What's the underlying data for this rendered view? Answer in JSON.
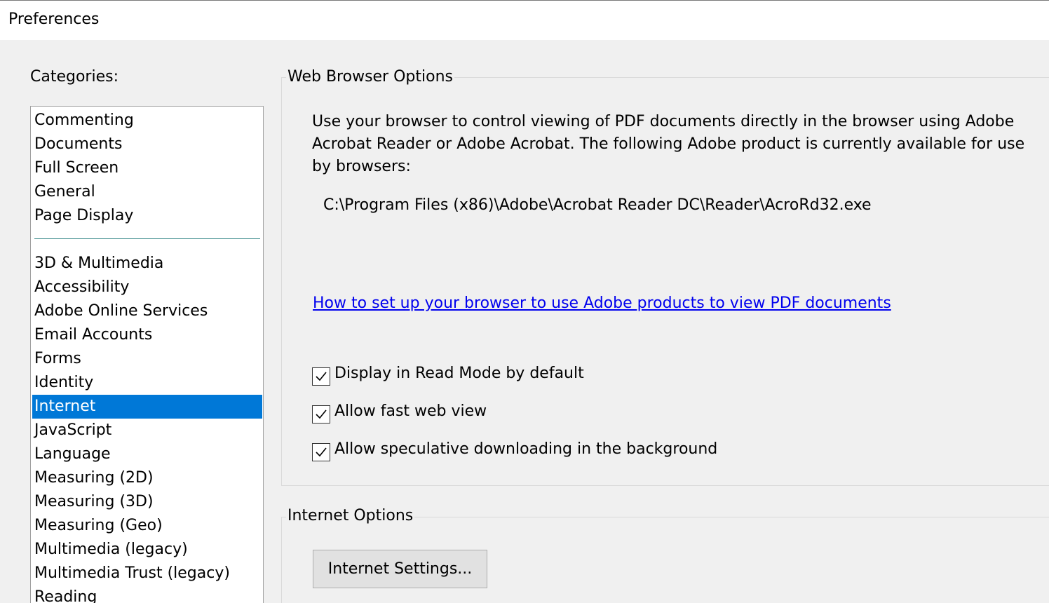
{
  "window": {
    "title": "Preferences"
  },
  "categories": {
    "label": "Categories:",
    "group_top": [
      "Commenting",
      "Documents",
      "Full Screen",
      "General",
      "Page Display"
    ],
    "group_bottom": [
      "3D & Multimedia",
      "Accessibility",
      "Adobe Online Services",
      "Email Accounts",
      "Forms",
      "Identity",
      "Internet",
      "JavaScript",
      "Language",
      "Measuring (2D)",
      "Measuring (3D)",
      "Measuring (Geo)",
      "Multimedia (legacy)",
      "Multimedia Trust (legacy)",
      "Reading"
    ],
    "selected": "Internet"
  },
  "web_browser_options": {
    "legend": "Web Browser Options",
    "description": "Use your browser to control viewing of PDF documents directly in the browser using Adobe Acrobat Reader or Adobe Acrobat. The following Adobe product is currently available for use by browsers:",
    "product_path": "C:\\Program Files (x86)\\Adobe\\Acrobat Reader DC\\Reader\\AcroRd32.exe",
    "help_link": "How to set up your browser to use Adobe products to view PDF documents",
    "checkboxes": [
      {
        "label": "Display in Read Mode by default",
        "checked": true
      },
      {
        "label": "Allow fast web view",
        "checked": true
      },
      {
        "label": "Allow speculative downloading in the background",
        "checked": true
      }
    ]
  },
  "internet_options": {
    "legend": "Internet Options",
    "settings_button": "Internet Settings..."
  },
  "colors": {
    "selection": "#0078d7",
    "link": "#0000ee",
    "background": "#f0f0f0"
  }
}
